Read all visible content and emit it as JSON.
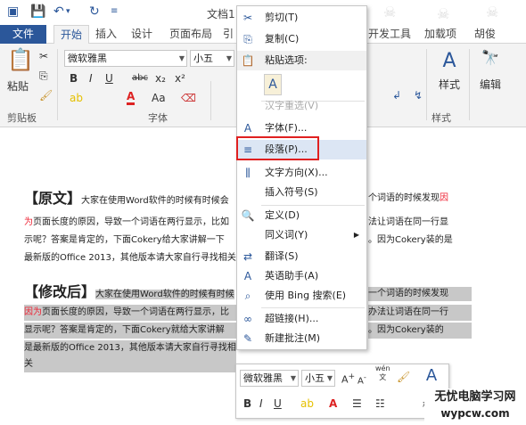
{
  "window": {
    "title": "文档1 [兼容"
  },
  "tabs": [
    "文件",
    "开始",
    "插入",
    "设计",
    "页面布局",
    "引",
    "开发工具",
    "加载项",
    "胡俊"
  ],
  "ribbon": {
    "paste_label": "粘贴",
    "clipboard_group": "剪贴板",
    "font_group": "字体",
    "font_name": "微软雅黑",
    "font_size": "小五",
    "style_label": "样式",
    "style_group": "样式",
    "edit_label": "编辑",
    "bold": "B",
    "italic": "I",
    "underline": "U",
    "strike": "abc",
    "sub": "x₂",
    "sup": "x²",
    "aa": "Aa",
    "aplus": "A",
    "aminus": "A",
    "fontcolor": "A"
  },
  "context_menu": {
    "items": [
      {
        "label": "剪切(T)",
        "icon": "scissors-icon",
        "glyph": "✂",
        "disabled": false
      },
      {
        "label": "复制(C)",
        "icon": "copy-icon",
        "glyph": "⎘",
        "disabled": false
      },
      {
        "label": "粘贴选项:",
        "icon": "paste-icon",
        "glyph": "📋",
        "disabled": false
      },
      {
        "label": "汉字重选(V)",
        "icon": "",
        "glyph": "",
        "disabled": true
      },
      {
        "label": "字体(F)...",
        "icon": "font-icon",
        "glyph": "A",
        "disabled": false
      },
      {
        "label": "段落(P)...",
        "icon": "paragraph-icon",
        "glyph": "≡",
        "disabled": false
      },
      {
        "label": "文字方向(X)...",
        "icon": "text-direction-icon",
        "glyph": "⫼",
        "disabled": false
      },
      {
        "label": "插入符号(S)",
        "icon": "",
        "glyph": "",
        "disabled": false
      },
      {
        "label": "定义(D)",
        "icon": "define-icon",
        "glyph": "🔍",
        "disabled": false
      },
      {
        "label": "同义词(Y)",
        "icon": "",
        "glyph": "",
        "disabled": false
      },
      {
        "label": "翻译(S)",
        "icon": "translate-icon",
        "glyph": "⇄",
        "disabled": false
      },
      {
        "label": "英语助手(A)",
        "icon": "english-assistant-icon",
        "glyph": "A",
        "disabled": false
      },
      {
        "label": "使用 Bing 搜索(E)",
        "icon": "bing-search-icon",
        "glyph": "⌕",
        "disabled": false
      },
      {
        "label": "超链接(H)...",
        "icon": "hyperlink-icon",
        "glyph": "∞",
        "disabled": false
      },
      {
        "label": "新建批注(M)",
        "icon": "new-comment-icon",
        "glyph": "✎",
        "disabled": false
      }
    ],
    "paste_keep_text": "A"
  },
  "document": {
    "p1_head": "【原文】",
    "p1_l1a": "大家在使用Word软件的时候有时候会",
    "p1_l1b": "个词语的时候发现",
    "p1_l1c": "因",
    "p1_l2a": "为",
    "p1_l2b": "页面长度的原因，导致一个词语在两行显示，比如",
    "p1_l2c": "法让词语在同一行显",
    "p1_l3a": "示呢？答案是肯定的，下面Cokery给大家讲解一下",
    "p1_l3b": "。因为Cokery装的是",
    "p1_l4": "最新版的Office 2013，其他版本请大家自行寻找相关",
    "p2_head": "【修改后】",
    "p2_l1a": "大家在使用Word软件的时候有时候",
    "p2_l1b": "一个词语的时候发现",
    "p2_l2a": "因为",
    "p2_l2b": "页面长度的原因，导致一个词语在两行显示，比",
    "p2_l2c": "办法让词语在同一行",
    "p2_l3a": "显示呢？答案是肯定的，下面Cokery就给大家讲解",
    "p2_l3b": "。因为Cokery装的",
    "p2_l4": "是最新版的Office 2013，其他版本请大家自行寻找相关"
  },
  "mini_toolbar": {
    "font_name": "微软雅黑",
    "font_size": "小五",
    "style_label": "样式",
    "wen": "wén"
  },
  "watermark": {
    "line1": "无忧电脑学习网",
    "line2": "wypcw.com"
  }
}
